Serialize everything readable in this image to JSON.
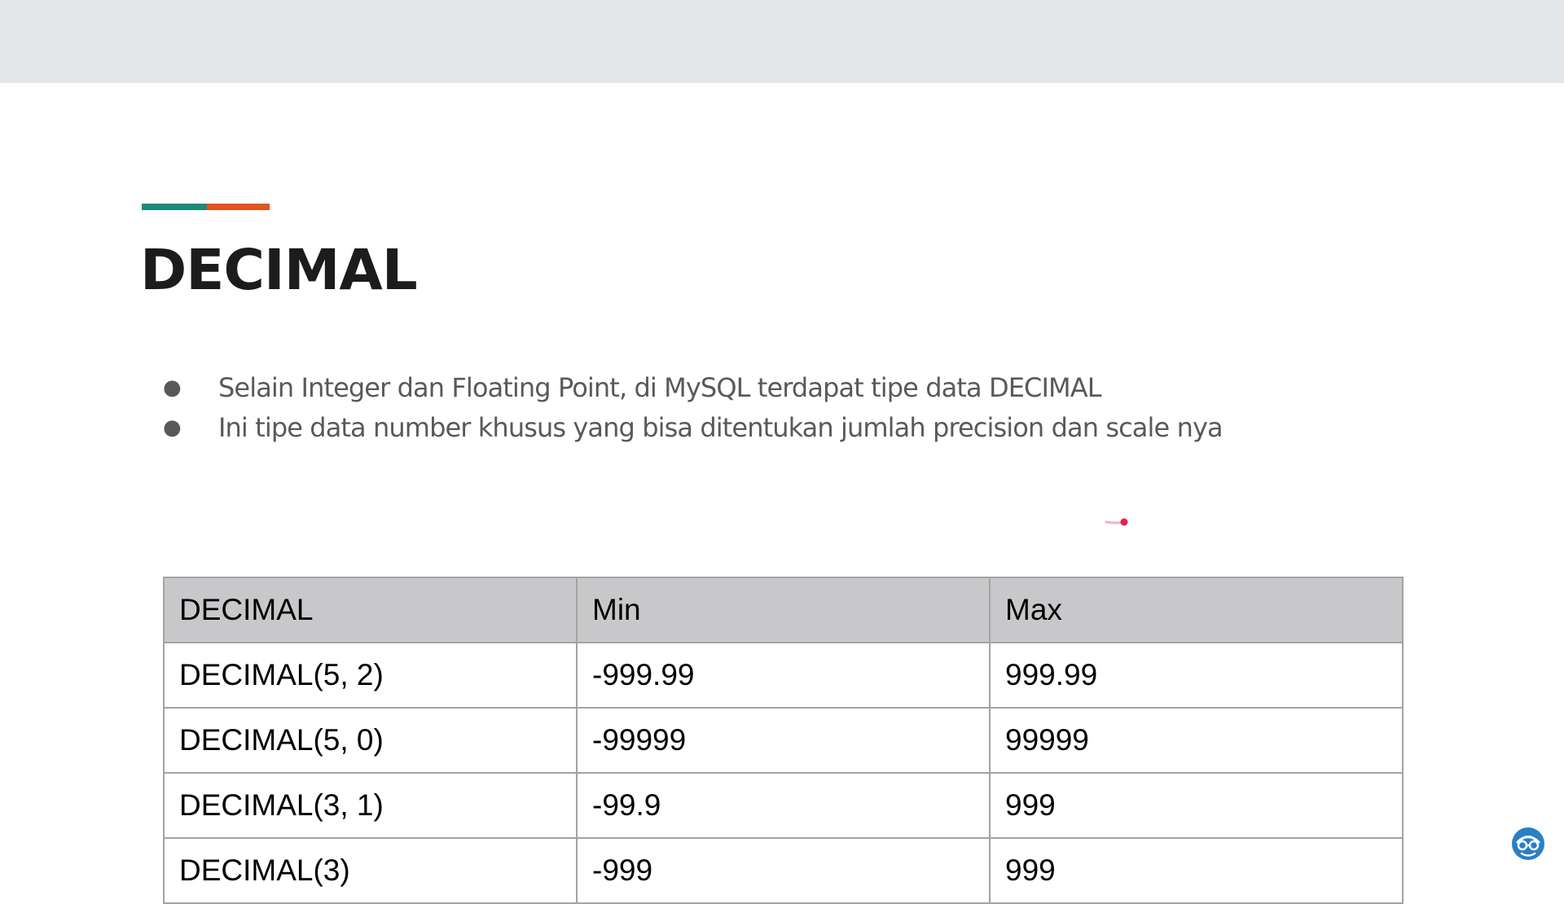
{
  "slide": {
    "title": "DECIMAL",
    "accent_colors": [
      "#1f8a78",
      "#e2531d"
    ],
    "bullets": [
      "Selain Integer dan Floating Point, di MySQL terdapat tipe data DECIMAL",
      "Ini tipe data number khusus yang bisa ditentukan jumlah precision dan scale nya"
    ],
    "bullet_glyph": "●"
  },
  "table": {
    "headers": [
      "DECIMAL",
      "Min",
      "Max"
    ],
    "rows": [
      [
        "DECIMAL(5, 2)",
        "-999.99",
        "999.99"
      ],
      [
        "DECIMAL(5, 0)",
        "-99999",
        "99999"
      ],
      [
        "DECIMAL(3, 1)",
        "-99.9",
        "999"
      ],
      [
        "DECIMAL(3)",
        "-999",
        "999"
      ]
    ]
  },
  "icons": {
    "pointer": "laser-pointer-icon",
    "logo": "glasses-avatar-logo-icon"
  },
  "colors": {
    "top_bar": "#e4e7ea",
    "header_fill": "#c8c8cb",
    "pointer": "#e8204a",
    "logo": "#2b7fc4"
  }
}
